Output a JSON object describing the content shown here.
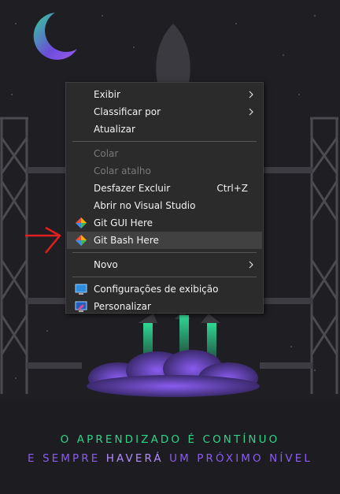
{
  "context_menu": {
    "items": [
      {
        "label": "Exibir",
        "submenu": true
      },
      {
        "label": "Classificar por",
        "submenu": true
      },
      {
        "label": "Atualizar"
      },
      {
        "label": "Colar",
        "disabled": true
      },
      {
        "label": "Colar atalho",
        "disabled": true
      },
      {
        "label": "Desfazer Excluir",
        "shortcut": "Ctrl+Z"
      },
      {
        "label": "Abrir no Visual Studio"
      },
      {
        "label": "Git GUI Here",
        "icon": "git-icon"
      },
      {
        "label": "Git Bash Here",
        "icon": "git-icon",
        "highlighted": true
      },
      {
        "label": "Novo",
        "submenu": true
      },
      {
        "label": "Configurações de exibição",
        "icon": "display-settings-icon"
      },
      {
        "label": "Personalizar",
        "icon": "personalize-icon"
      }
    ]
  },
  "wallpaper": {
    "line1": "O APRENDIZADO É CONTÍNUO",
    "line2": {
      "part1": "E SEMPRE",
      "part2": "HAVERÁ",
      "part3": "UM PRÓXIMO NÍVEL"
    },
    "colors": {
      "background": "#1d1d22",
      "line1": "#2bd687",
      "line2": "#8a5cf0",
      "moon": "#7b4fd8",
      "flame": "#34c98a",
      "smoke": "#7a4fe0"
    }
  },
  "annotation": {
    "arrow_color": "#e02020"
  }
}
